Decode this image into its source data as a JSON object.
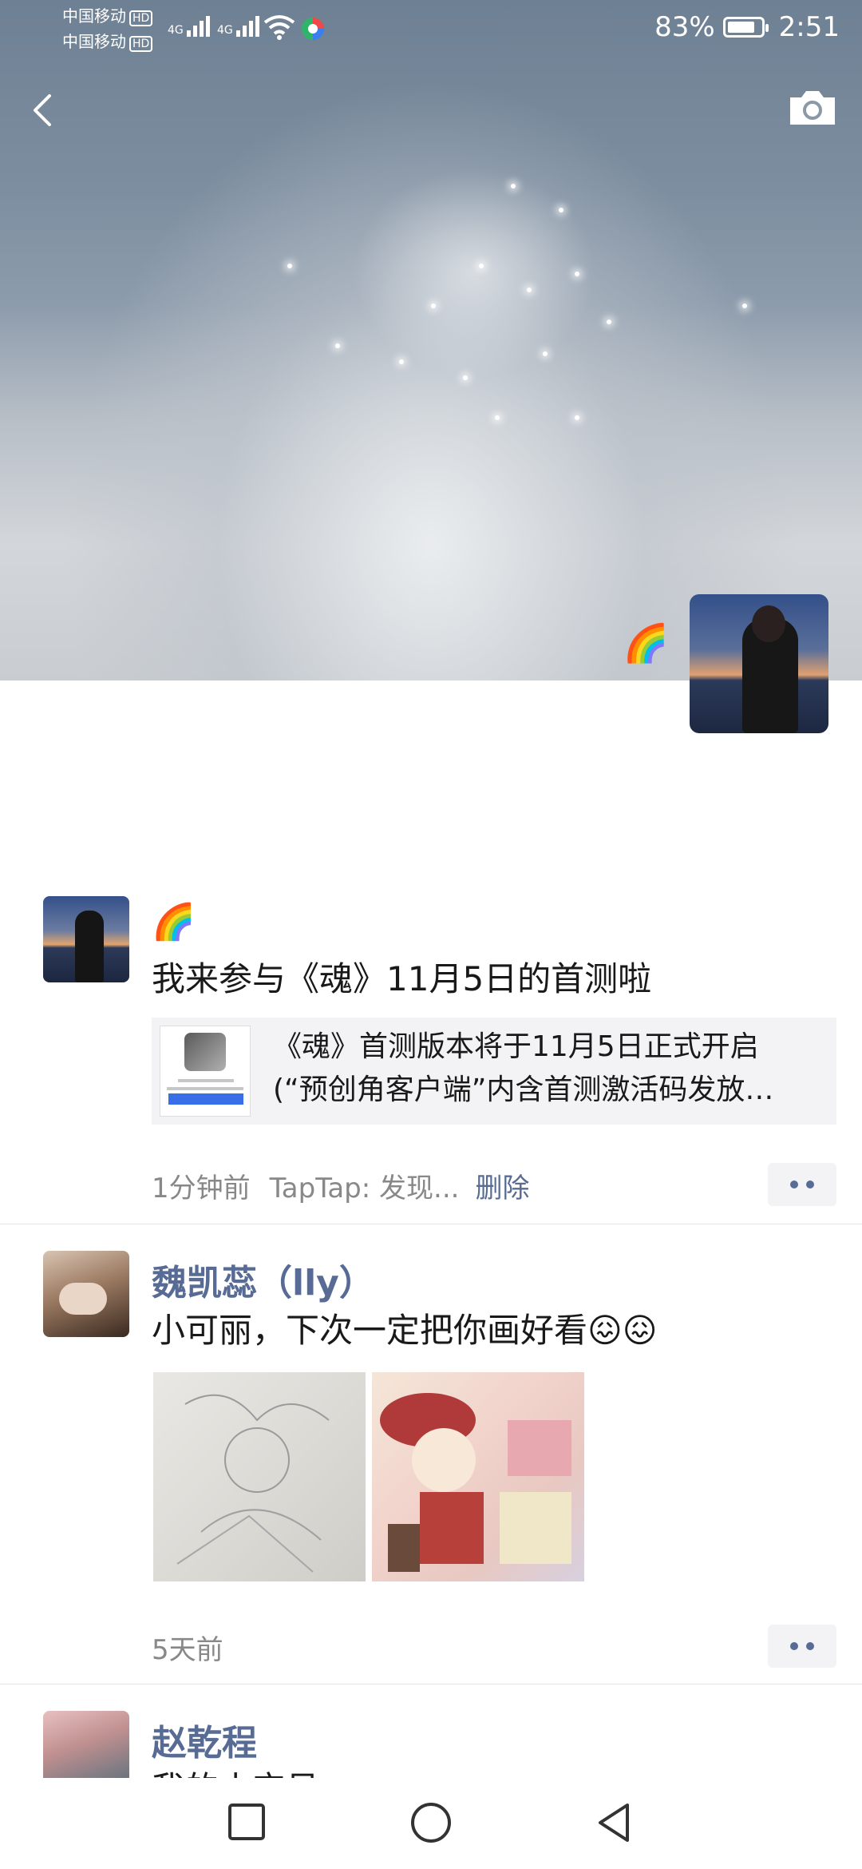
{
  "status_bar": {
    "carrier_1": "中国移动",
    "carrier_2": "中国移动",
    "hd_badge": "HD",
    "net_1": "4G",
    "net_2": "4G",
    "battery_percent": "83%",
    "battery_level": 0.83,
    "time": "2:51"
  },
  "header": {
    "back_icon": "chevron-left-icon",
    "camera_icon": "camera-icon"
  },
  "profile": {
    "name_emoji": "🌈"
  },
  "posts": [
    {
      "name_emoji": "🌈",
      "text": "我来参与《魂》11月5日的首测啦",
      "link_title_1": "《魂》首测版本将于11月5日正式开启",
      "link_title_2": "(“预创角客户端”内含首测激活码发放…",
      "time": "1分钟前",
      "source": "TapTap: 发现...",
      "delete_label": "删除"
    },
    {
      "name": "魏凯蕊（lly）",
      "text": "小可丽，下次一定把你画好看😖😖",
      "time": "5天前"
    },
    {
      "name": "赵乾程",
      "text": "我的小宝贝"
    }
  ],
  "navbar": {
    "recent_icon": "square-icon",
    "home_icon": "circle-icon",
    "back_icon": "triangle-back-icon"
  }
}
